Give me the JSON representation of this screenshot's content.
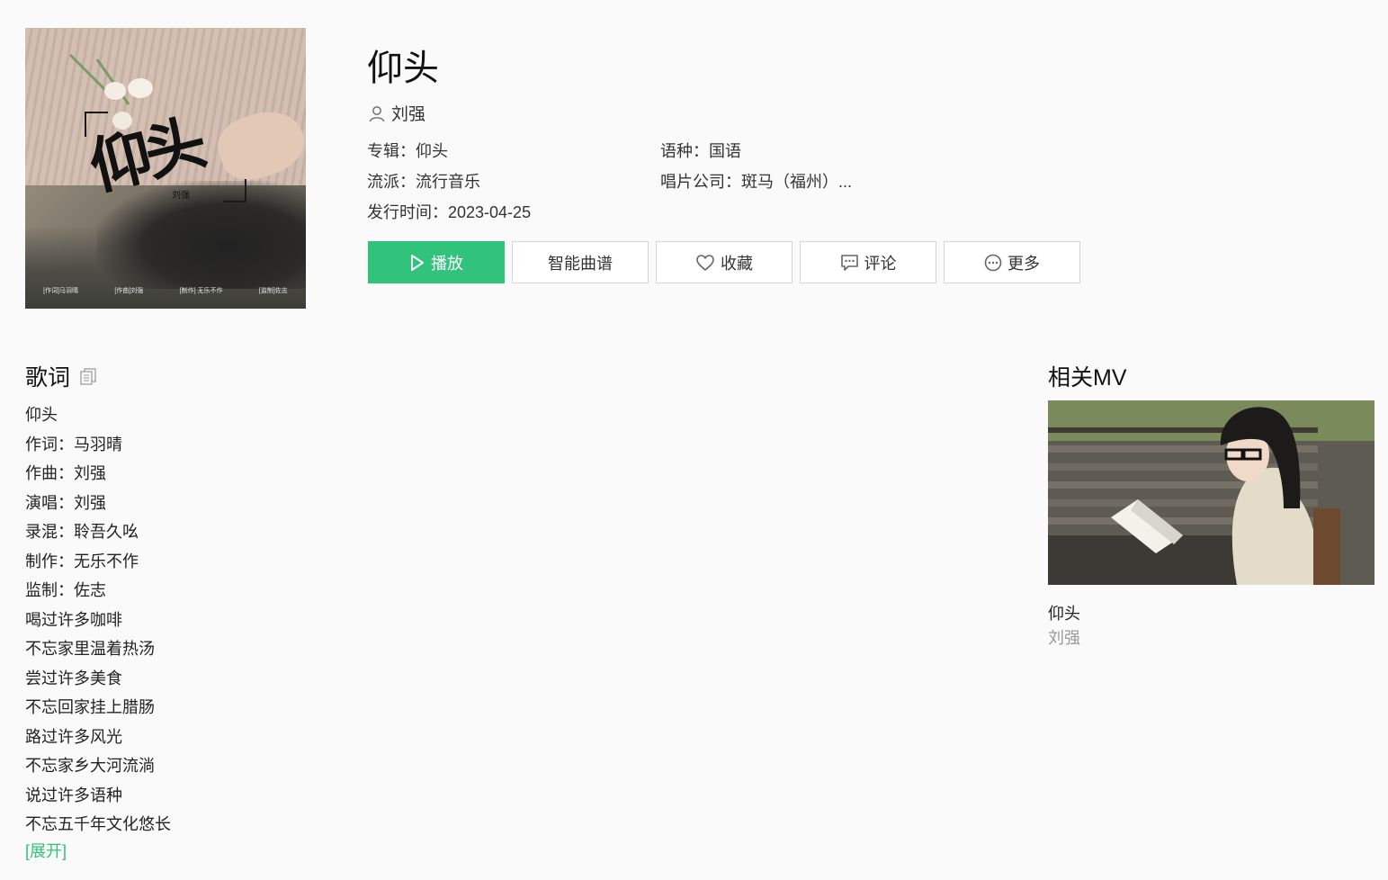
{
  "cover": {
    "title": "仰头",
    "artist": "刘强",
    "credits": [
      "[作词]马羽晴",
      "[作曲]刘强",
      "[制作] 无乐不作",
      "[监制]佐志"
    ]
  },
  "song": {
    "title": "仰头",
    "artist": "刘强",
    "album_label": "专辑：",
    "album": "仰头",
    "language_label": "语种：",
    "language": "国语",
    "genre_label": "流派：",
    "genre": "流行音乐",
    "label_label": "唱片公司：",
    "record_label": "斑马（福州）...",
    "release_label": "发行时间：",
    "release_date": "2023-04-25"
  },
  "actions": {
    "play": "播放",
    "score": "智能曲谱",
    "favorite": "收藏",
    "comment": "评论",
    "more": "更多"
  },
  "lyrics": {
    "title": "歌词",
    "lines": [
      "仰头",
      "作词：马羽晴",
      "作曲：刘强",
      "演唱：刘强",
      "录混：聆吾久吆",
      "制作：无乐不作",
      "监制：佐志",
      "喝过许多咖啡",
      "不忘家里温着热汤",
      "尝过许多美食",
      "不忘回家挂上腊肠",
      "路过许多风光",
      "不忘家乡大河流淌",
      "说过许多语种",
      "不忘五千年文化悠长"
    ],
    "expand": "[展开]"
  },
  "mv": {
    "section_title": "相关MV",
    "title": "仰头",
    "artist": "刘强"
  },
  "colors": {
    "accent": "#31c27c",
    "background": "#fafafa",
    "muted": "#999999"
  }
}
